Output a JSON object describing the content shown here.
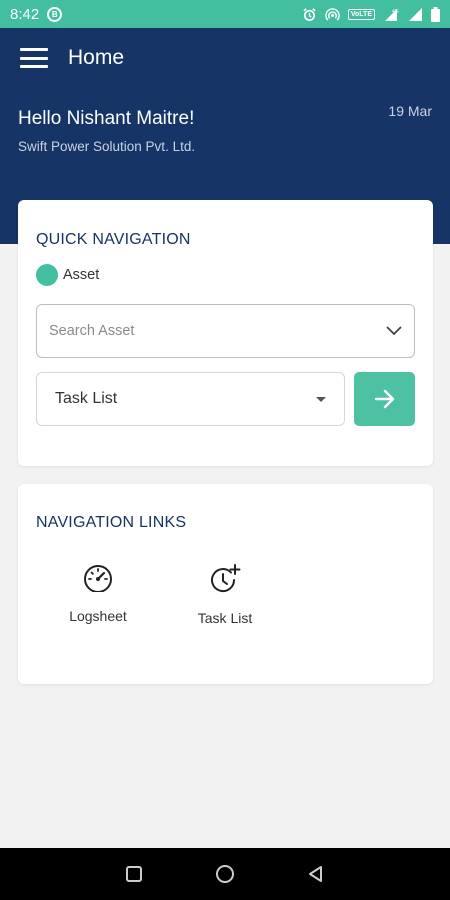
{
  "status_bar": {
    "time": "8:42",
    "left_icon": "B",
    "volte": "VoLTE",
    "background": "#43bfa0"
  },
  "header": {
    "title": "Home",
    "greeting": "Hello Nishant Maitre!",
    "company": "Swift Power Solution Pvt. Ltd.",
    "date": "19 Mar",
    "background": "#173466"
  },
  "quick_navigation": {
    "title": "QUICK NAVIGATION",
    "asset_label": "Asset",
    "search_placeholder": "Search Asset",
    "task_select_value": "Task List",
    "accent": "#43bfa0"
  },
  "navigation_links": {
    "title": "NAVIGATION LINKS",
    "items": [
      {
        "label": "Logsheet",
        "icon": "speedometer-icon"
      },
      {
        "label": "Task List",
        "icon": "clock-plus-icon"
      }
    ]
  },
  "system_nav": {
    "buttons": [
      "recents-icon",
      "home-icon",
      "back-icon"
    ]
  }
}
